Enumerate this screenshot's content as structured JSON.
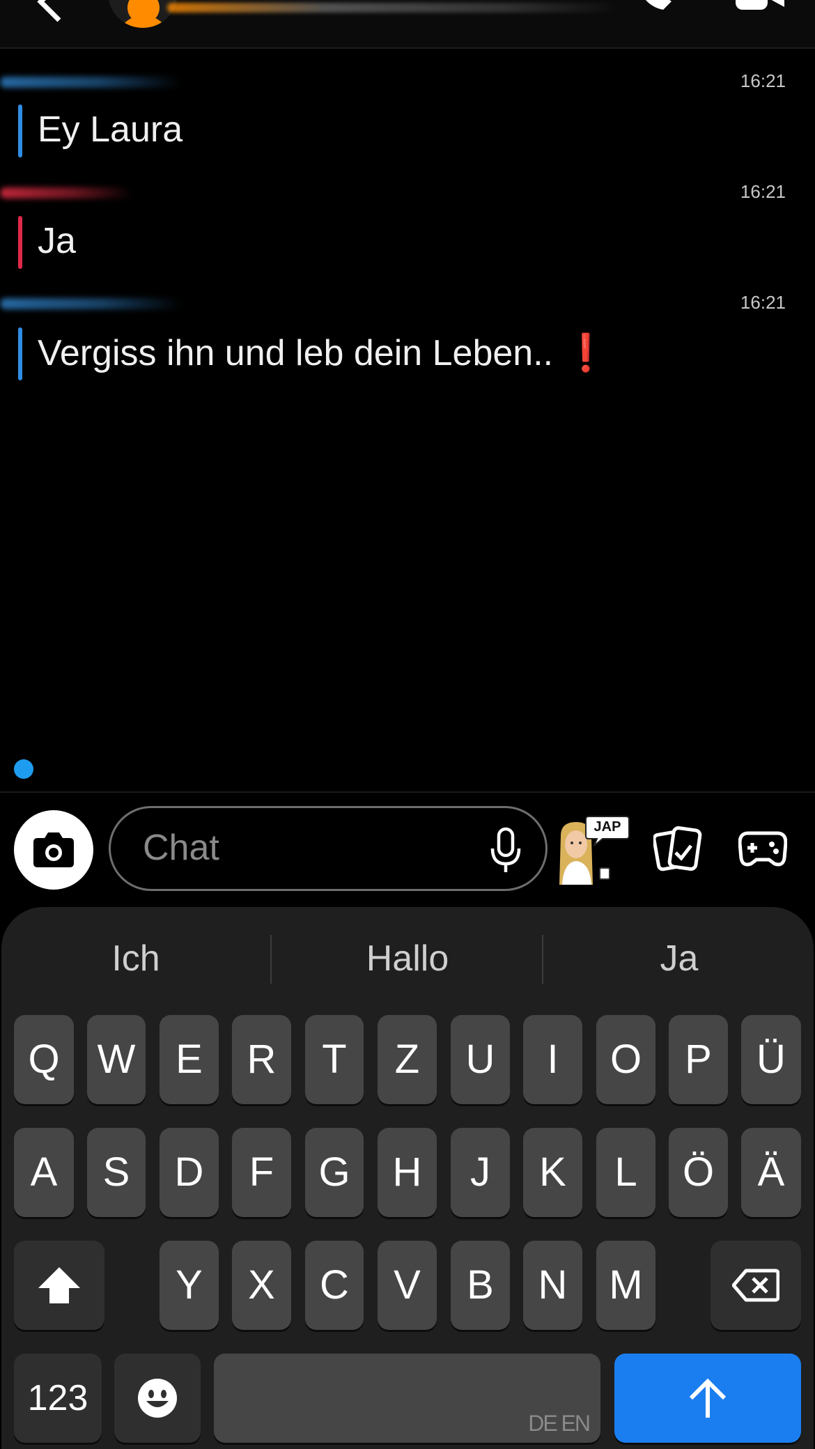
{
  "messages": [
    {
      "time": "16:21",
      "sender_color": "blue",
      "text": "Ey Laura"
    },
    {
      "time": "16:21",
      "sender_color": "red",
      "text": "Ja"
    },
    {
      "time": "16:21",
      "sender_color": "blue",
      "text": "Vergiss ihn und leb dein Leben.. ",
      "emoji": "❗"
    }
  ],
  "composer": {
    "placeholder": "Chat",
    "bitmoji_bubble": "JAP"
  },
  "suggestions": [
    "Ich",
    "Hallo",
    "Ja"
  ],
  "keyboard": {
    "row1": [
      "Q",
      "W",
      "E",
      "R",
      "T",
      "Z",
      "U",
      "I",
      "O",
      "P",
      "Ü"
    ],
    "row2": [
      "A",
      "S",
      "D",
      "F",
      "G",
      "H",
      "J",
      "K",
      "L",
      "Ö",
      "Ä"
    ],
    "row3": [
      "Y",
      "X",
      "C",
      "V",
      "B",
      "N",
      "M"
    ],
    "numbers_label": "123",
    "language_label": "DE EN"
  },
  "colors": {
    "accent_blue": "#2f8de4",
    "accent_red": "#e0294a",
    "send_key": "#1b7ef0",
    "typing_dot": "#1e9df0"
  },
  "icons": {
    "back": "chevron-left-icon",
    "call": "phone-icon",
    "video": "video-camera-icon",
    "camera": "camera-icon",
    "mic": "microphone-icon",
    "cards": "memories-cards-icon",
    "games": "gamepad-icon",
    "shift": "shift-arrow-icon",
    "delete": "backspace-icon",
    "emoji": "emoji-face-icon",
    "send": "send-arrow-icon"
  }
}
